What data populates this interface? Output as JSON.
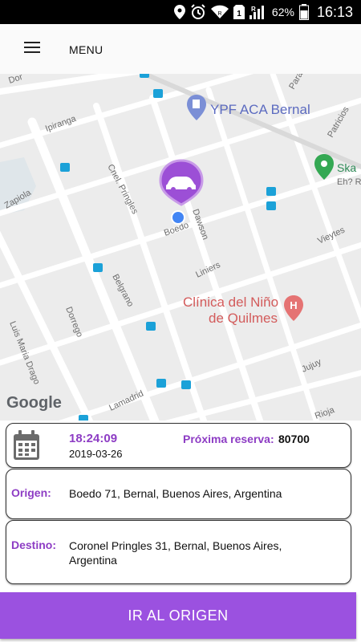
{
  "status_bar": {
    "battery": "62%",
    "time": "16:13",
    "icons": [
      "location-icon",
      "alarm-icon",
      "wifi-icon",
      "sim1-icon",
      "signal-icon",
      "battery-icon"
    ]
  },
  "app_bar": {
    "menu_icon": "hamburger-icon",
    "menu_label": "MENU"
  },
  "map": {
    "streets": [
      "Ipiranga",
      "Zapiola",
      "Cnel. Pringles",
      "Boedo",
      "Dawson",
      "Liniers",
      "Belgrano",
      "Dorrego",
      "Luis Maria Drago",
      "Lamadrid",
      "Vieytes",
      "Jujuy",
      "Rioja",
      "Patricios",
      "Paraná",
      "Dor"
    ],
    "places": [
      {
        "name": "YPF ACA Bernal",
        "icon": "gas-station-icon"
      },
      {
        "name": "Clínica del Niño\nde Quilmes",
        "line1": "Clínica del Niño",
        "line2": "de Quilmes",
        "icon": "hospital-icon"
      },
      {
        "name": "Ska",
        "line2": "Eh? R",
        "icon": "place-icon"
      }
    ],
    "logo": "Google",
    "colors": {
      "pin": "#9c4fd6",
      "location_dot": "#4285f4",
      "hospital": "#e57373",
      "place": "#34a853",
      "transit": "#1ba1d8"
    }
  },
  "trip": {
    "calendar_icon": "calendar-icon",
    "time": "18:24:09",
    "date": "2019-03-26",
    "reservation_label": "Próxima reserva:",
    "reservation_value": "80700",
    "origin_label": "Origen:",
    "origin_value": "Boedo 71, Bernal, Buenos Aires, Argentina",
    "destination_label": "Destino:",
    "destination_value": "Coronel Pringles 31, Bernal, Buenos Aires, Argentina"
  },
  "action": {
    "go_label": "IR AL ORIGEN",
    "color": "#9b51e0"
  }
}
